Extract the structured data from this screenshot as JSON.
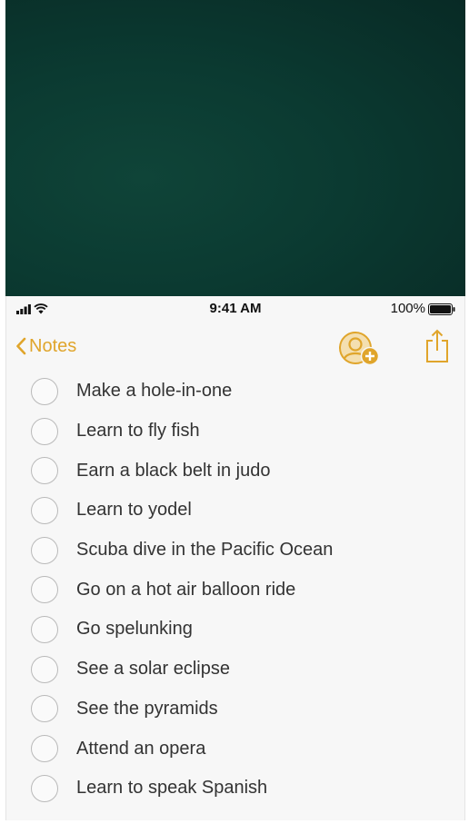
{
  "status_bar": {
    "time": "9:41 AM",
    "battery_percent": "100%",
    "battery_level": 1.0,
    "signal_icon": "signal-bars-icon",
    "wifi_icon": "wifi-icon",
    "battery_icon": "battery-icon"
  },
  "nav": {
    "back_label": "Notes",
    "back_icon": "chevron-left-icon",
    "add_person_icon": "add-person-icon",
    "share_icon": "share-icon",
    "accent_color": "#e0a52b"
  },
  "checklist": {
    "items": [
      {
        "label": "Make a hole-in-one",
        "checked": false
      },
      {
        "label": "Learn to fly fish",
        "checked": false
      },
      {
        "label": "Earn a black belt in judo",
        "checked": false
      },
      {
        "label": "Learn to yodel",
        "checked": false
      },
      {
        "label": "Scuba dive in the Pacific Ocean",
        "checked": false
      },
      {
        "label": "Go on a hot air balloon ride",
        "checked": false
      },
      {
        "label": "Go spelunking",
        "checked": false
      },
      {
        "label": "See a solar eclipse",
        "checked": false
      },
      {
        "label": "See the pyramids",
        "checked": false
      },
      {
        "label": "Attend an opera",
        "checked": false
      },
      {
        "label": "Learn to speak Spanish",
        "checked": false
      }
    ]
  },
  "colors": {
    "background_top": "#0b3a31",
    "note_background": "#f7f7f7",
    "accent": "#e0a52b",
    "checkbox_border": "#b9b9b9",
    "text": "#333333"
  }
}
